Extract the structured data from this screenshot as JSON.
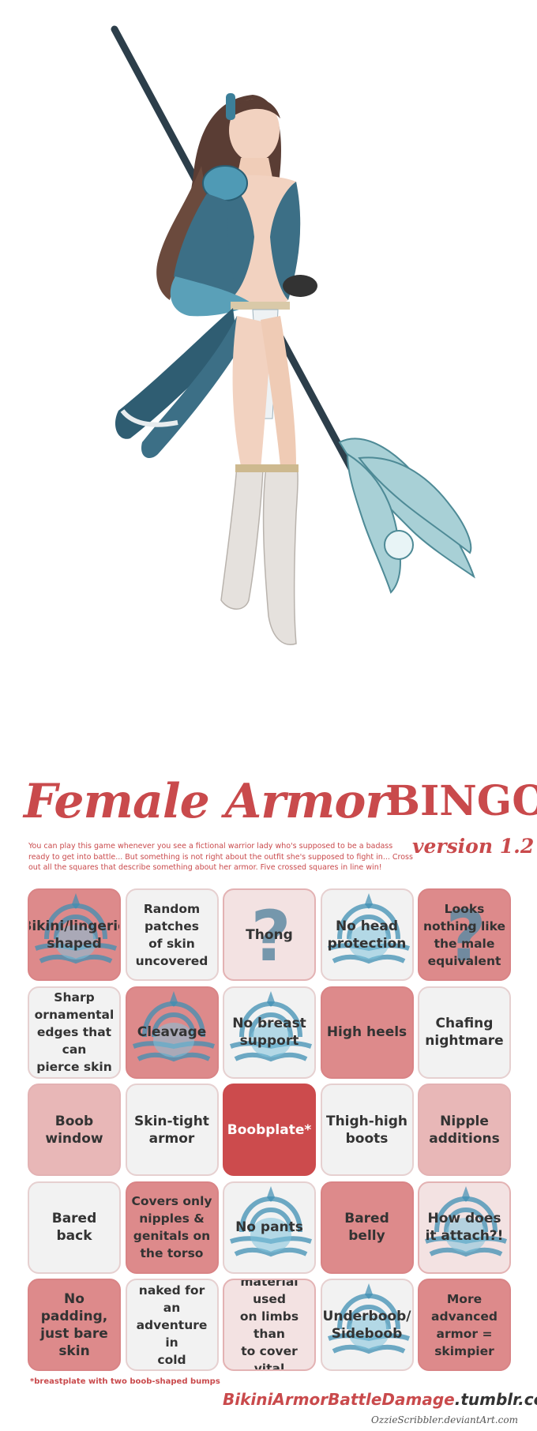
{
  "title": {
    "script": "Female Armor",
    "bingo": "BINGO",
    "version": "version 1.2"
  },
  "intro": "You can play this game whenever you see a fictional warrior lady who's supposed to be a badass ready to get into battle... But something is not right about the outfit she's supposed to fight in... Cross out all the squares that describe something about her armor. Five crossed squares in line win!",
  "cells": [
    {
      "label": "Bikini/lingerie\nshaped",
      "style": "pink",
      "emblem": true
    },
    {
      "label": "Random\npatches\nof skin\nuncovered",
      "style": "pale"
    },
    {
      "label": "Thong",
      "style": "light",
      "question": true
    },
    {
      "label": "No head\nprotection",
      "style": "pale",
      "emblem": true
    },
    {
      "label": "Looks\nnothing like\nthe male\nequivalent",
      "style": "pink",
      "question": true
    },
    {
      "label": "Sharp\nornamental\nedges that can\npierce skin",
      "style": "pale"
    },
    {
      "label": "Cleavage",
      "style": "pink",
      "emblem": true
    },
    {
      "label": "No breast\nsupport",
      "style": "pale",
      "emblem": true
    },
    {
      "label": "High heels",
      "style": "pink"
    },
    {
      "label": "Chafing\nnightmare",
      "style": "pale"
    },
    {
      "label": "Boob\nwindow",
      "style": "mid"
    },
    {
      "label": "Skin-tight\narmor",
      "style": "pale"
    },
    {
      "label": "Boobplate*",
      "style": "red"
    },
    {
      "label": "Thigh-high\nboots",
      "style": "pale"
    },
    {
      "label": "Nipple\nadditions",
      "style": "mid"
    },
    {
      "label": "Bared back",
      "style": "pale"
    },
    {
      "label": "Covers only\nnipples &\ngenitals on\nthe torso",
      "style": "pink"
    },
    {
      "label": "No pants",
      "style": "pale",
      "emblem": true
    },
    {
      "label": "Bared\nbelly",
      "style": "pink"
    },
    {
      "label": "How does\nit attach?!",
      "style": "light",
      "emblem": true
    },
    {
      "label": "No padding,\njust bare skin",
      "style": "pink"
    },
    {
      "label": "Almost\nnaked for an\nadventure in\ncold climate",
      "style": "pale"
    },
    {
      "label": "More\nmaterial used\non limbs than\nto cover vital\norgans",
      "style": "light"
    },
    {
      "label": "Underboob/\nSideboob",
      "style": "pale",
      "emblem": true
    },
    {
      "label": "More\nadvanced\narmor =\nskimpier",
      "style": "pink"
    }
  ],
  "footnote": "*breastplate with two boob-shaped bumps",
  "site": {
    "red": "BikiniArmorBattleDamage",
    "dark": ".tumblr.com"
  },
  "credit": "OzzieScribbler.deviantArt.com",
  "colors": {
    "accent": "#c94a4c",
    "pink": "#dd8a8b",
    "light": "#f3e2e2",
    "pale": "#f2f2f2",
    "emblem": "#3f8fb3"
  }
}
